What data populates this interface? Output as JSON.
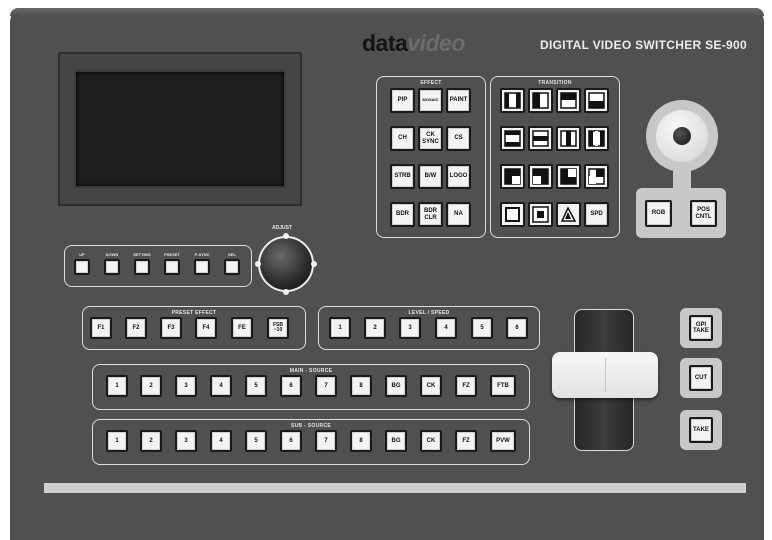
{
  "header": {
    "brand_dark": "data",
    "brand_light": "video",
    "product_title": "DIGITAL VIDEO SWITCHER  SE-900"
  },
  "effect": {
    "label": "EFFECT",
    "buttons": [
      "PIP",
      "MOSAIC",
      "PAINT",
      "CH",
      "CK SYNC",
      "CS",
      "STRB",
      "B/W",
      "LOGO",
      "BDR",
      "BDR CLR",
      "NA"
    ]
  },
  "transition": {
    "label": "TRANSITION",
    "spd_label": "SPD"
  },
  "joystick": {
    "rgb_label": "RGB",
    "pos_cntl_label": "POS CNTL"
  },
  "menu": {
    "labels": [
      "UP",
      "DOWN",
      "SETTING",
      "PRESET",
      "P-SYNC",
      "SEL"
    ]
  },
  "adjust": {
    "label": "ADJUST"
  },
  "preset_effect": {
    "label": "PRESET EFFECT",
    "buttons": [
      "F1",
      "F2",
      "F3",
      "F4",
      "FE",
      "FSB ~10"
    ]
  },
  "level_speed": {
    "label": "LEVEL / SPEED",
    "buttons": [
      "1",
      "2",
      "3",
      "4",
      "5",
      "6"
    ]
  },
  "main_source": {
    "label": "MAIN - SOURCE",
    "buttons": [
      "1",
      "2",
      "3",
      "4",
      "5",
      "6",
      "7",
      "8",
      "BG",
      "CK",
      "FZ",
      "FTB"
    ]
  },
  "sub_source": {
    "label": "SUB - SOURCE",
    "buttons": [
      "1",
      "2",
      "3",
      "4",
      "5",
      "6",
      "7",
      "8",
      "BG",
      "CK",
      "FZ",
      "PVW"
    ]
  },
  "take_controls": {
    "gpi_take": "GPI TAKE",
    "cut": "CUT",
    "take": "TAKE"
  },
  "colors": {
    "panel": "#505050",
    "button": "#f3f3f3",
    "outline": "#dcdcdc"
  }
}
